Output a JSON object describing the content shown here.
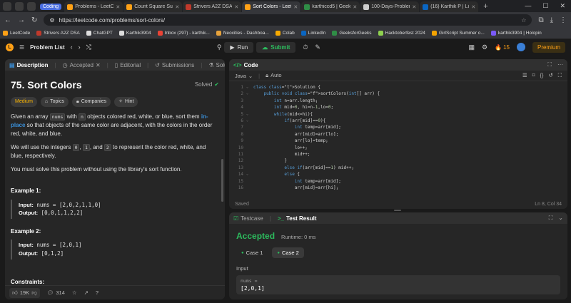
{
  "browser": {
    "group_label": "Coding",
    "tabs": [
      {
        "title": "Problems - LeetCo",
        "color": "#ffa116"
      },
      {
        "title": "Count Square Sub",
        "color": "#ffa116"
      },
      {
        "title": "Strivers A2Z DSA",
        "color": "#c0392b"
      },
      {
        "title": "Sort Colors - Leet",
        "color": "#ffa116",
        "active": true
      },
      {
        "title": "karthiccd5 | Geeks",
        "color": "#2f8d46"
      },
      {
        "title": "100-Days-Problem",
        "color": "#cccccc"
      },
      {
        "title": "(16) Karthik P | Lin",
        "color": "#0a66c2"
      }
    ],
    "url": "https://leetcode.com/problems/sort-colors/",
    "bookmarks": [
      {
        "label": "LeetCode",
        "color": "#ffa116"
      },
      {
        "label": "Strivers A2Z DSA",
        "color": "#c0392b"
      },
      {
        "label": "ChatGPT",
        "color": "#dddddd"
      },
      {
        "label": "Karthik3904",
        "color": "#dddddd"
      },
      {
        "label": "Inbox (297) - karthik...",
        "color": "#ea4335"
      },
      {
        "label": "Neocities - Dashboa...",
        "color": "#e6a23c"
      },
      {
        "label": "Colab",
        "color": "#f9ab00"
      },
      {
        "label": "LinkedIn",
        "color": "#0a66c2"
      },
      {
        "label": "GeeksforGeeks",
        "color": "#2f8d46"
      },
      {
        "label": "Hacktoberfest 2024",
        "color": "#8fd14f"
      },
      {
        "label": "GirlScript Summer o...",
        "color": "#f4a300"
      },
      {
        "label": "karthik3904 | Holopin",
        "color": "#7a5af8"
      }
    ]
  },
  "header": {
    "problem_list": "Problem List",
    "run": "Run",
    "submit": "Submit",
    "streak": "15",
    "premium": "Premium"
  },
  "left_tabs": [
    "Description",
    "Accepted",
    "Editorial",
    "Submissions",
    "Solutions"
  ],
  "problem": {
    "title": "75. Sort Colors",
    "status": "Solved",
    "difficulty": "Medium",
    "tags": [
      "Topics",
      "Companies",
      "Hint"
    ],
    "p1": {
      "a": "Given an array ",
      "c1": "nums",
      "b": " with ",
      "c2": "n",
      "c": " objects colored red, white, or blue, sort them ",
      "link": "in-place",
      "d": " so that objects of the same color are adjacent, with the colors in the order red, white, and blue."
    },
    "p2": {
      "a": "We will use the integers ",
      "c1": "0",
      "b": ", ",
      "c2": "1",
      "c": ", and ",
      "c3": "2",
      "d": " to represent the color red, white, and blue, respectively."
    },
    "p3": "You must solve this problem without using the library's sort function.",
    "examples": [
      {
        "heading": "Example 1:",
        "input_label": "Input:",
        "input": "nums = [2,0,2,1,1,0]",
        "output_label": "Output:",
        "output": "[0,0,1,1,2,2]"
      },
      {
        "heading": "Example 2:",
        "input_label": "Input:",
        "input": "nums = [2,0,1]",
        "output_label": "Output:",
        "output": "[0,1,2]"
      }
    ],
    "constraints": "Constraints:",
    "likes": "19K",
    "comments": "314"
  },
  "code": {
    "tab": "Code",
    "language": "Java",
    "mode": "Auto",
    "lines": [
      "class Solution {",
      "    public void sortColors(int[] arr) {",
      "        int n=arr.length;",
      "        int mid=0, hi=n-1,lo=0;",
      "        while(mid<=hi){",
      "            if(arr[mid]==0){",
      "                int temp=arr[mid];",
      "                arr[mid]=arr[lo];",
      "                arr[lo]=temp;",
      "                lo++;",
      "                mid++;",
      "            }",
      "            else if(arr[mid]==1) mid++;",
      "            else {",
      "                int temp=arr[mid];",
      "                arr[mid]=arr[hi];"
    ],
    "saved": "Saved",
    "cursor": "Ln 8, Col 34"
  },
  "result": {
    "tabs": [
      "Testcase",
      "Test Result"
    ],
    "verdict": "Accepted",
    "runtime": "Runtime: 0 ms",
    "cases": [
      "Case 1",
      "Case 2"
    ],
    "input_heading": "Input",
    "input_label": "nums =",
    "input_value": "[2,0,1]"
  }
}
